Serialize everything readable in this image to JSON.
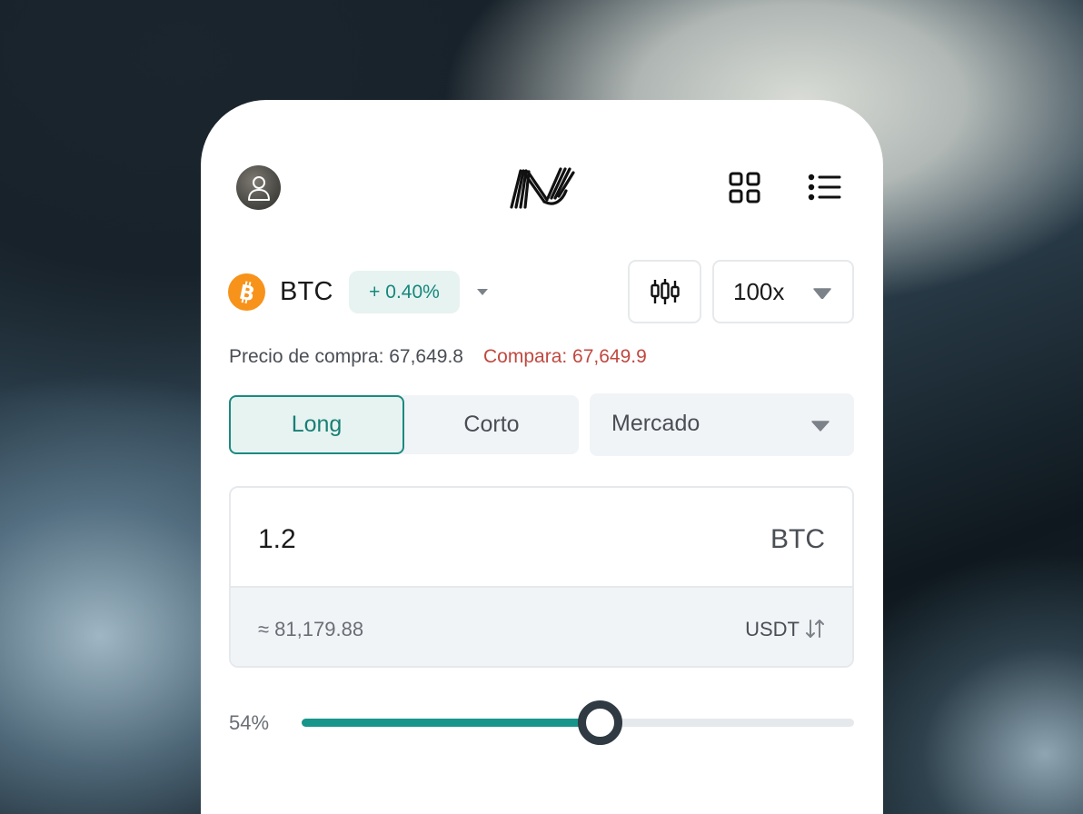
{
  "header": {
    "avatar_icon": "user-icon",
    "logo_icon": "brand-logo",
    "grid_icon": "grid-icon",
    "menu_icon": "list-icon"
  },
  "pair": {
    "asset_icon": "bitcoin-icon",
    "symbol": "BTC",
    "change": "+ 0.40%",
    "change_color": "#16877b",
    "chart_icon": "candlestick-icon",
    "leverage": "100x"
  },
  "prices": {
    "buy": "Precio de compra: 67,649.8",
    "compare": "Compara: 67,649.9",
    "compare_color": "#c0483f"
  },
  "order": {
    "side_long": "Long",
    "side_short": "Corto",
    "selected_side": "Long",
    "type": "Mercado"
  },
  "amount": {
    "value": "1.2",
    "unit": "BTC",
    "converted": "≈ 81,179.88",
    "converted_unit": "USDT",
    "swap_icon": "swap-arrows-icon"
  },
  "slider": {
    "label": "54%",
    "value": 0.54,
    "accent": "#17958a"
  }
}
